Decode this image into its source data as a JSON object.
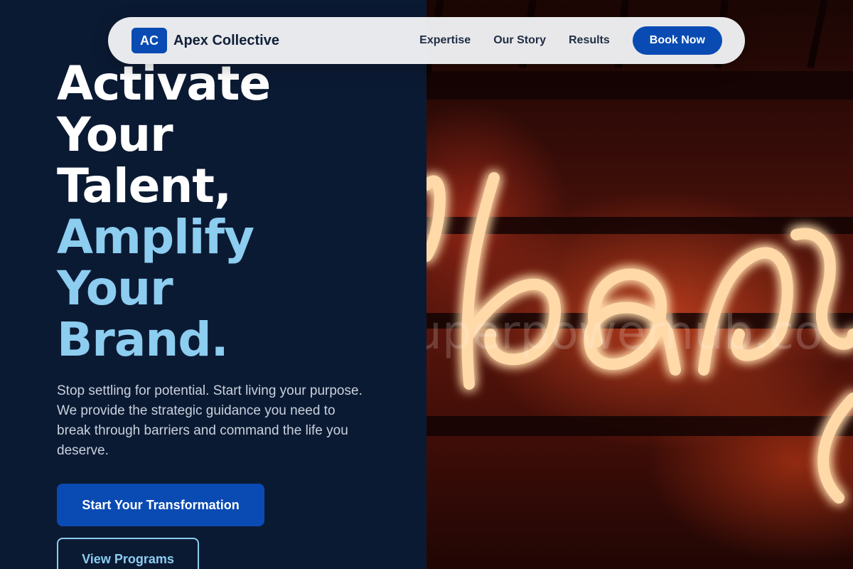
{
  "nav": {
    "logo_badge": "AC",
    "brand_name": "Apex Collective",
    "links": [
      "Expertise",
      "Our Story",
      "Results"
    ],
    "cta": "Book Now"
  },
  "hero": {
    "headline_white": [
      "Activate",
      "Your",
      "Talent,"
    ],
    "headline_blue": [
      "Amplify",
      "Your",
      "Brand."
    ],
    "subtext": "Stop settling for potential. Start living your purpose. We provide the strategic guidance you need to break through barriers and command the life you deserve.",
    "primary_cta": "Start Your Transformation",
    "secondary_cta": "View Programs"
  },
  "image": {
    "watermark": "uperpowerhub.co"
  },
  "colors": {
    "background": "#0b1a33",
    "accent": "#0a4bb3",
    "highlight": "#8ccdf0",
    "nav_bg": "#f0f1f4"
  }
}
